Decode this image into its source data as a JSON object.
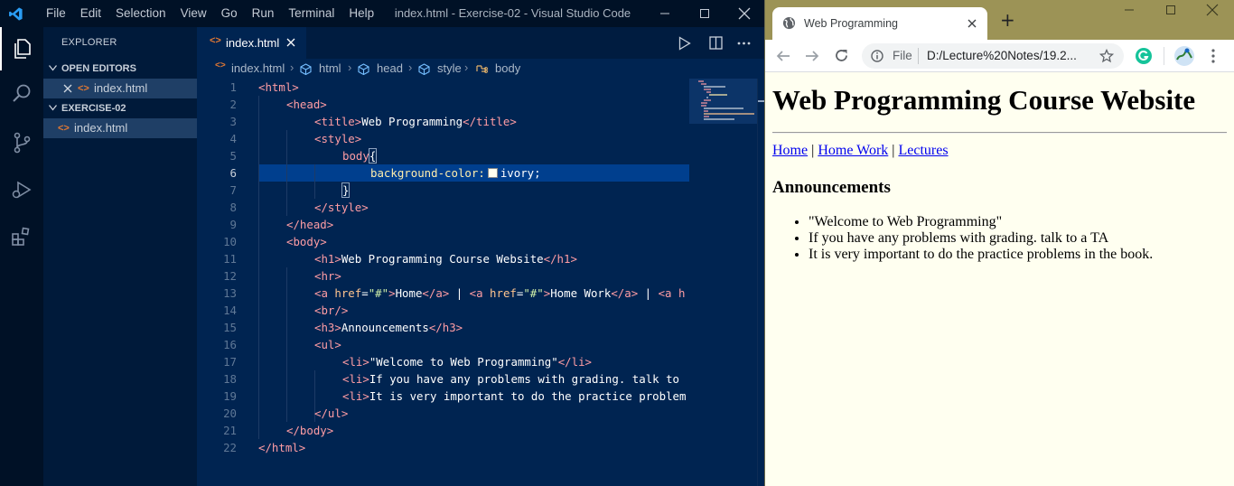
{
  "vscode": {
    "menu": [
      "File",
      "Edit",
      "Selection",
      "View",
      "Go",
      "Run",
      "Terminal",
      "Help"
    ],
    "window_title": "index.html - Exercise-02 - Visual Studio Code",
    "explorer": {
      "title": "EXPLORER",
      "open_editors_label": "OPEN EDITORS",
      "open_file": "index.html",
      "folder_label": "EXERCISE-02",
      "folder_file": "index.html"
    },
    "tab_label": "index.html",
    "breadcrumb": [
      "index.html",
      "html",
      "head",
      "style",
      "body"
    ],
    "line_numbers": [
      "1",
      "2",
      "3",
      "4",
      "5",
      "6",
      "7",
      "8",
      "9",
      "10",
      "11",
      "12",
      "13",
      "14",
      "15",
      "16",
      "17",
      "18",
      "19",
      "20",
      "21",
      "22"
    ],
    "code": {
      "l1": "<html>",
      "l2": "<head>",
      "l3a": "<title>",
      "l3b": "Web Programming",
      "l3c": "</title>",
      "l4": "<style>",
      "l5a": "body",
      "l5b": "{",
      "l6a": "background-color:",
      "l6b": "ivory;",
      "l7": "}",
      "l8": "</style>",
      "l9": "</head>",
      "l10": "<body>",
      "l11a": "<h1>",
      "l11b": "Web Programming Course Website",
      "l11c": "</h1>",
      "l12": "<hr>",
      "l13a": "<a ",
      "l13b": "href",
      "l13c": "=",
      "l13d": "\"#\"",
      "l13e": ">",
      "l13f": "Home",
      "l13g": "</a>",
      "l13h": " | ",
      "l13i": "<a ",
      "l13j": "href",
      "l13k": "=",
      "l13l": "\"#\"",
      "l13m": ">",
      "l13n": "Home Work",
      "l13o": "</a>",
      "l13p": " | ",
      "l13q": "<a h",
      "l14": "<br/>",
      "l15a": "<h3>",
      "l15b": "Announcements",
      "l15c": "</h3>",
      "l16": "<ul>",
      "l17a": "<li>",
      "l17b": "\"Welcome to Web Programming\"",
      "l17c": "</li>",
      "l18a": "<li>",
      "l18b": "If you have any problems with grading. talk to",
      "l19a": "<li>",
      "l19b": "It is very important to do the practice problem",
      "l20": "</ul>",
      "l21": "</body>",
      "l22": "</html>"
    }
  },
  "browser": {
    "tab_title": "Web Programming",
    "new_tab": "+",
    "url_scheme": "File",
    "url": "D:/Lecture%20Notes/19.2...",
    "page": {
      "h1": "Web Programming Course Website",
      "nav": [
        "Home",
        "Home Work",
        "Lectures"
      ],
      "separator": "|",
      "h3": "Announcements",
      "list": [
        "\"Welcome to Web Programming\"",
        "If you have any problems with grading. talk to a TA",
        "It is very important to do the practice problems in the book."
      ]
    }
  },
  "colors": {
    "editor_bg": "#002451",
    "tag": "#ff9da4",
    "attribute": "#ffc58f",
    "string": "#d1f1a9",
    "property": "#ffeead",
    "page_bg": "#fffff0",
    "link": "#0000ee",
    "chrome_frame": "#9c9356"
  }
}
